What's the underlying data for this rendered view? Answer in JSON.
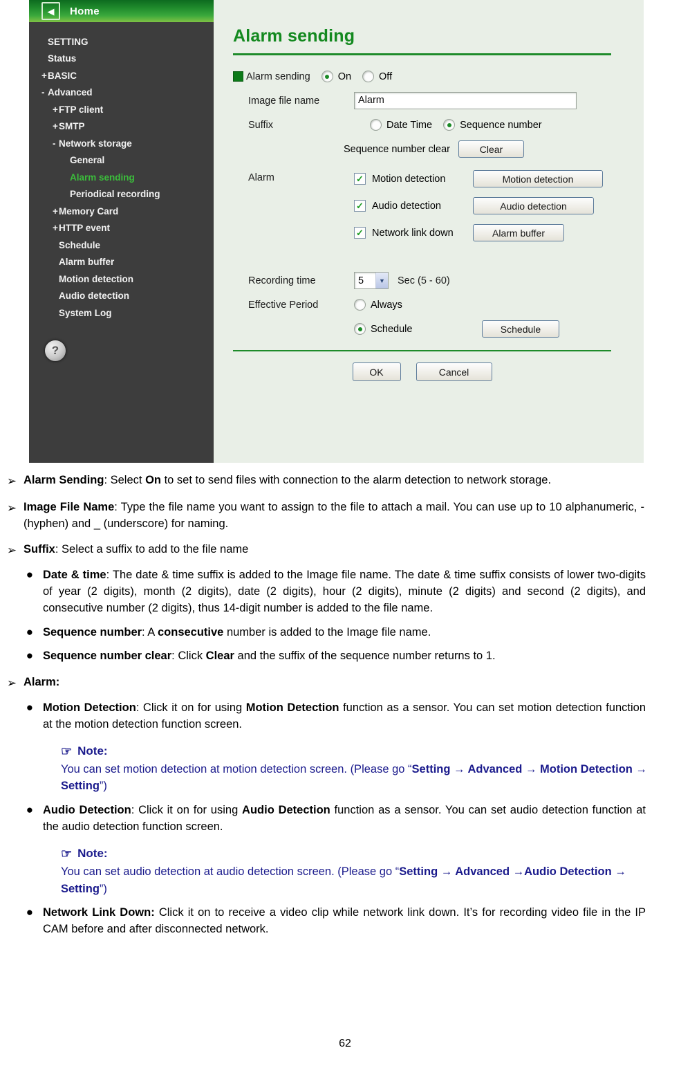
{
  "screenshot": {
    "home_bar": {
      "back_icon": "back-arrow-icon",
      "label": "Home"
    },
    "sidebar": {
      "items": [
        {
          "prefix": "",
          "label": "SETTING",
          "indent": 0,
          "active": false
        },
        {
          "prefix": "",
          "label": "Status",
          "indent": 0,
          "active": false
        },
        {
          "prefix": "+",
          "label": "BASIC",
          "indent": 0,
          "active": false
        },
        {
          "prefix": "-",
          "label": "Advanced",
          "indent": 0,
          "active": false
        },
        {
          "prefix": "+",
          "label": "FTP client",
          "indent": 1,
          "active": false
        },
        {
          "prefix": "+",
          "label": "SMTP",
          "indent": 1,
          "active": false
        },
        {
          "prefix": "-",
          "label": "Network storage",
          "indent": 1,
          "active": false
        },
        {
          "prefix": "",
          "label": "General",
          "indent": 2,
          "active": false
        },
        {
          "prefix": "",
          "label": "Alarm sending",
          "indent": 2,
          "active": true
        },
        {
          "prefix": "",
          "label": "Periodical recording",
          "indent": 2,
          "active": false
        },
        {
          "prefix": "+",
          "label": "Memory Card",
          "indent": 1,
          "active": false
        },
        {
          "prefix": "+",
          "label": "HTTP event",
          "indent": 1,
          "active": false
        },
        {
          "prefix": "",
          "label": "Schedule",
          "indent": 1,
          "active": false
        },
        {
          "prefix": "",
          "label": "Alarm buffer",
          "indent": 1,
          "active": false
        },
        {
          "prefix": "",
          "label": "Motion detection",
          "indent": 1,
          "active": false
        },
        {
          "prefix": "",
          "label": "Audio detection",
          "indent": 1,
          "active": false
        },
        {
          "prefix": "",
          "label": "System Log",
          "indent": 1,
          "active": false
        }
      ],
      "help_icon_label": "?"
    },
    "form": {
      "title": "Alarm sending",
      "alarm_sending_label": "Alarm sending",
      "on_label": "On",
      "off_label": "Off",
      "on_selected": true,
      "image_file_name_label": "Image file name",
      "image_file_name_value": "Alarm",
      "suffix_label": "Suffix",
      "date_time_label": "Date Time",
      "sequence_number_label": "Sequence number",
      "suffix_selected": "Sequence number",
      "sequence_number_clear_label": "Sequence number clear",
      "clear_button": "Clear",
      "alarm_label": "Alarm",
      "alarm_rows": [
        {
          "checked": true,
          "label": "Motion detection",
          "button": "Motion detection"
        },
        {
          "checked": true,
          "label": "Audio detection",
          "button": "Audio detection"
        },
        {
          "checked": true,
          "label": "Network link down",
          "button": "Alarm buffer"
        }
      ],
      "recording_time_label": "Recording time",
      "recording_time_value": "5",
      "recording_time_unit": "Sec (5 - 60)",
      "effective_period_label": "Effective Period",
      "always_label": "Always",
      "schedule_label": "Schedule",
      "schedule_button": "Schedule",
      "effective_period_selected": "Schedule",
      "ok_button": "OK",
      "cancel_button": "Cancel"
    },
    "colors": {
      "accent_green": "#13891f",
      "sidebar_bg": "#3d3d3d",
      "panel_bg": "#e9efe7",
      "active_item": "#3bbd3b"
    }
  },
  "doc": {
    "marker_arrow": "➢",
    "marker_dot": "●",
    "hand_icon": "☞",
    "note_label": "Note:",
    "items": [
      {
        "level": 1,
        "html": "<b>Alarm Sending</b>: Select <b>On</b> to set to send files with connection to the alarm detection to network storage."
      },
      {
        "level": 1,
        "html": "<b>Image File Name</b>: Type the file name you want to assign to the file to attach a mail. You can use up to 10 alphanumeric, - (hyphen) and _ (underscore) for naming."
      },
      {
        "level": 1,
        "html": "<b>Suffix</b>: Select a suffix to add to the file name"
      },
      {
        "level": 2,
        "html": "<b>Date &amp; time</b>: The date &amp; time suffix is added to the Image file name. The date &amp; time suffix consists of lower two-digits of year (2 digits), month (2 digits), date (2 digits), hour (2 digits), minute (2 digits) and second (2 digits), and consecutive number (2 digits), thus 14-digit number is added to the file name."
      },
      {
        "level": 2,
        "html": "<b>Sequence number</b>: A <b>consecutive</b> number is added to the Image file name."
      },
      {
        "level": 2,
        "html": "<b>Sequence number clear</b>: Click <b>Clear</b> and the suffix of the sequence number returns to 1."
      },
      {
        "level": 1,
        "html": "<b>Alarm:</b>"
      },
      {
        "level": 2,
        "html": "<b>Motion Detection</b>: Click it on for using <b>Motion Detection</b> function as a sensor. You can set motion detection function at the motion detection function screen."
      },
      {
        "level": "note",
        "html": "You can set motion detection at motion detection screen. (Please go “<b>Setting → Advanced → Motion Detection → Setting</b>”)"
      },
      {
        "level": 2,
        "html": "<b>Audio Detection</b>: Click it on for using <b>Audio Detection</b> function as a sensor. You can set audio detection function at the audio detection function screen."
      },
      {
        "level": "note",
        "html": "You can set audio detection at audio detection screen. (Please go “<b>Setting → Advanced →Audio Detection → Setting</b>”)"
      },
      {
        "level": 2,
        "html": "<b>Network Link Down:</b> Click it on to receive a video clip while network link down. It’s for recording video file in the IP CAM before and after disconnected network."
      }
    ],
    "page_number": "62"
  }
}
